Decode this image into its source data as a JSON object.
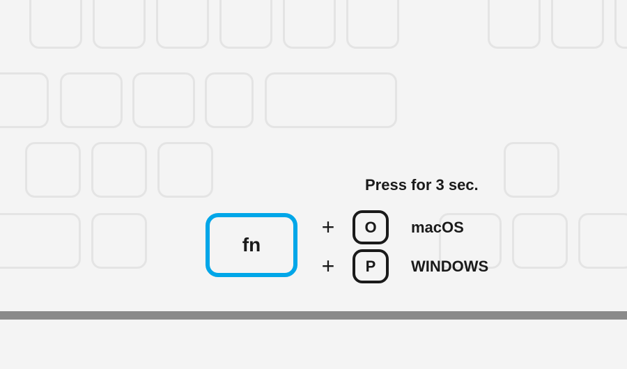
{
  "instruction": "Press for 3 sec.",
  "fn_key": {
    "label": "fn"
  },
  "combos": [
    {
      "plus": "+",
      "key": "O",
      "os": "macOS"
    },
    {
      "plus": "+",
      "key": "P",
      "os": "WINDOWS"
    }
  ],
  "colors": {
    "highlight": "#00a6e8",
    "key_outline": "#e4e4e4",
    "ink": "#1a1a1a"
  }
}
